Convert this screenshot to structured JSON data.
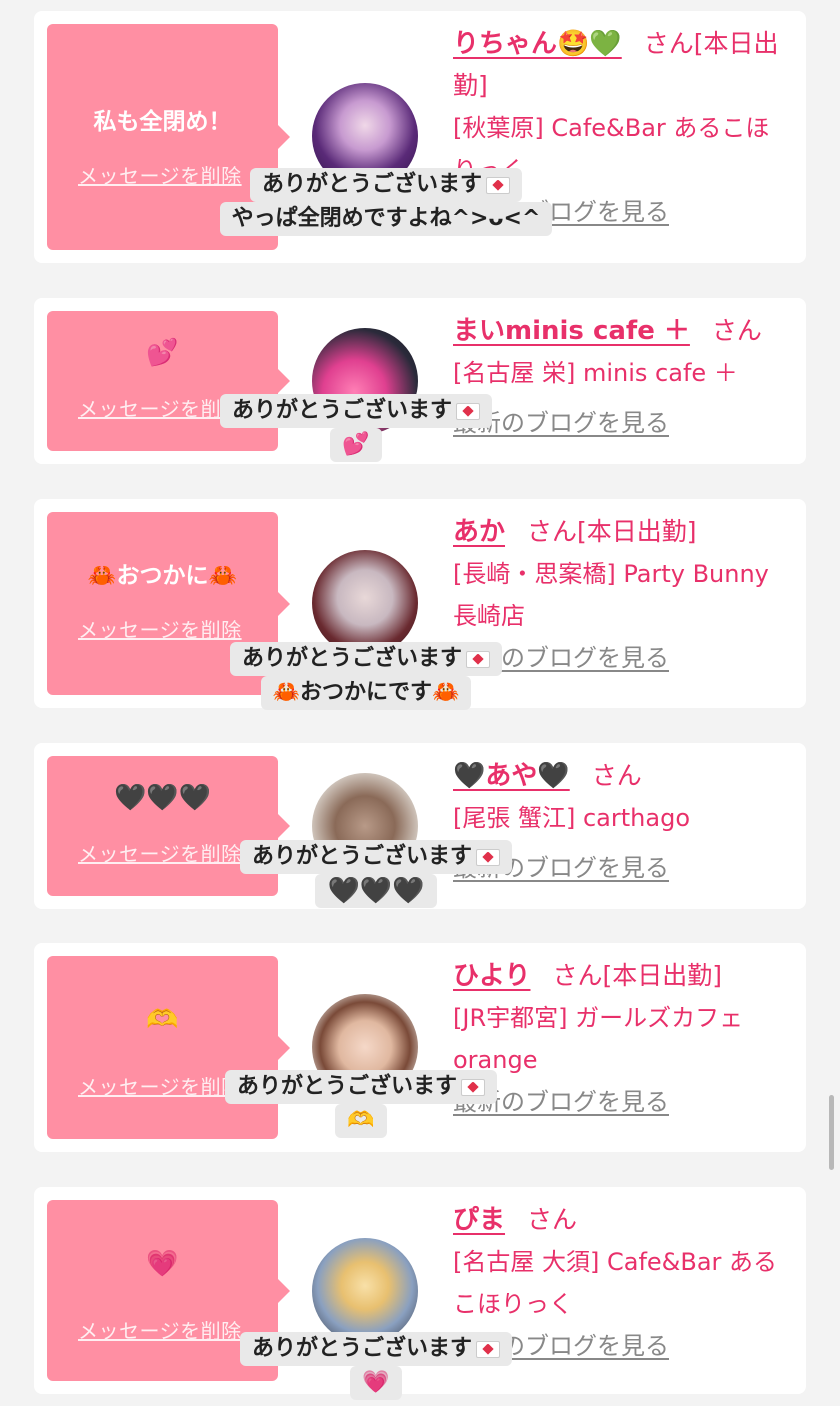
{
  "cards": [
    {
      "name": "りちゃん🤩💚",
      "san": "さん",
      "status": "[本日出勤]",
      "shop": "[秋葉原] Cafe&Bar あるこほりっく",
      "blog": "最新のブログを見る",
      "message": "私も全閉め！",
      "delete": "メッセージを削除",
      "reply": [
        "ありがとうございます",
        "やっぱ全閉めですよね^>ᴗ<^"
      ]
    },
    {
      "name": "まいminis cafe ＋",
      "san": "さん",
      "status": "",
      "shop": "[名古屋 栄] minis cafe ＋",
      "blog": "最新のブログを見る",
      "message": "💕",
      "delete": "メッセージを削除",
      "reply": [
        "ありがとうございます",
        "💕"
      ]
    },
    {
      "name": "あか",
      "san": "さん",
      "status": "[本日出勤]",
      "shop": "[長崎・思案橋] Party Bunny 長崎店",
      "blog": "最新のブログを見る",
      "message": "🦀おつかに🦀",
      "delete": "メッセージを削除",
      "reply": [
        "ありがとうございます",
        "🦀おつかにです🦀"
      ]
    },
    {
      "name": "🖤あや🖤",
      "san": "さん",
      "status": "",
      "shop": "[尾張 蟹江] carthago",
      "blog": "最新のブログを見る",
      "message": "🖤🖤🖤",
      "delete": "メッセージを削除",
      "reply": [
        "ありがとうございます",
        "🖤🖤🖤"
      ]
    },
    {
      "name": "ひより",
      "san": "さん",
      "status": "[本日出勤]",
      "shop": "[JR宇都宮] ガールズカフェorange",
      "blog": "最新のブログを見る",
      "message": "🫶",
      "delete": "メッセージを削除",
      "reply": [
        "ありがとうございます",
        "🫶"
      ]
    },
    {
      "name": "ぴま",
      "san": "さん",
      "status": "",
      "shop": "[名古屋 大須] Cafe&Bar あるこほりっく",
      "blog": "最新のブログを見る",
      "message": "💗",
      "delete": "メッセージを削除",
      "reply": [
        "ありがとうございます",
        "💗"
      ]
    }
  ],
  "icons": {
    "envelope": "love-letter-icon",
    "avatar": "avatar-photo"
  },
  "colors": {
    "accent": "#e8306a",
    "message_bg": "#ff8fa3",
    "page_bg": "#f3f3f3",
    "link_gray": "#888888"
  }
}
